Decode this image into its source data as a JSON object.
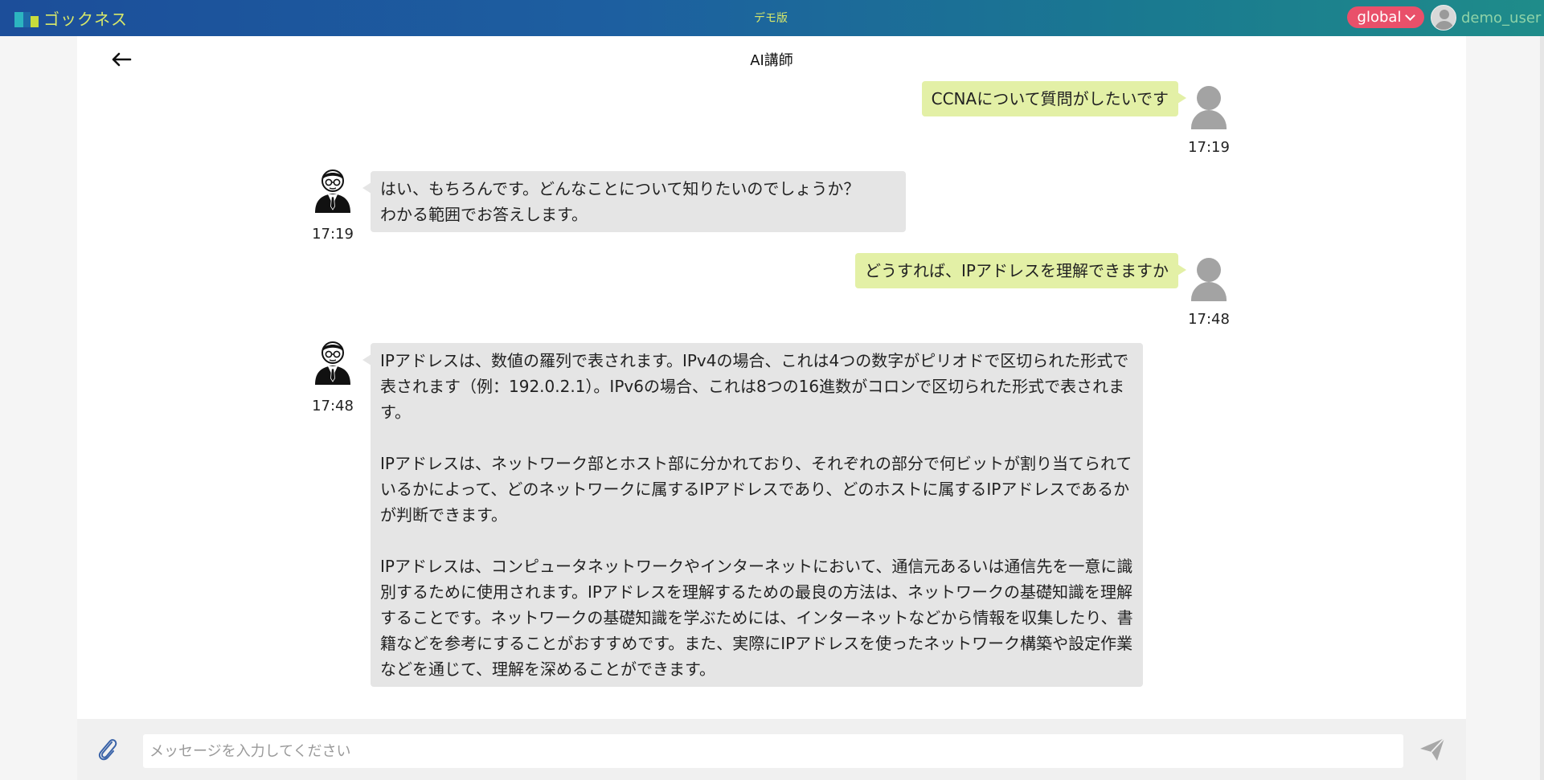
{
  "header": {
    "logo_text": "ゴックネス",
    "demo_label": "デモ版",
    "scope": "global",
    "username": "demo_user"
  },
  "chat": {
    "title": "AI講師",
    "messages": [
      {
        "role": "user",
        "text": "CCNAについて質問がしたいです",
        "time": "17:19"
      },
      {
        "role": "bot",
        "paragraphs": [
          "はい、もちろんです。どんなことについて知りたいのでしょうか？\nわかる範囲でお答えします。"
        ],
        "time": "17:19"
      },
      {
        "role": "user",
        "text": "どうすれば、IPアドレスを理解できますか",
        "time": "17:48"
      },
      {
        "role": "bot",
        "paragraphs": [
          "IPアドレスは、数値の羅列で表されます。IPv4の場合、これは4つの数字がピリオドで区切られた形式で表されます（例：192.0.2.1）。IPv6の場合、これは8つの16進数がコロンで区切られた形式で表されます。",
          "IPアドレスは、ネットワーク部とホスト部に分かれており、それぞれの部分で何ビットが割り当てられているかによって、どのネットワークに属するIPアドレスであり、どのホストに属するIPアドレスであるかが判断できます。",
          "IPアドレスは、コンピュータネットワークやインターネットにおいて、通信元あるいは通信先を一意に識別するために使用されます。IPアドレスを理解するための最良の方法は、ネットワークの基礎知識を理解することです。ネットワークの基礎知識を学ぶためには、インターネットなどから情報を収集したり、書籍などを参考にすることがおすすめです。また、実際にIPアドレスを使ったネットワーク構築や設定作業などを通じて、理解を深めることができます。"
        ],
        "time": "17:48"
      }
    ]
  },
  "composer": {
    "placeholder": "メッセージを入力してください",
    "value": ""
  },
  "icons": {
    "back": "arrow-left-icon",
    "attach": "paperclip-icon",
    "send": "send-icon",
    "user_avatar": "user-avatar-icon",
    "bot_avatar": "teacher-avatar-icon",
    "dropdown": "chevron-down-icon"
  },
  "colors": {
    "header_start": "#1c4e9a",
    "header_end": "#1f8c8a",
    "accent_lime": "#d7e86a",
    "scope_badge": "#e9506a",
    "user_bubble": "#e3f0a6",
    "bot_bubble": "#e5e5e5",
    "username": "#8fd3a8"
  }
}
